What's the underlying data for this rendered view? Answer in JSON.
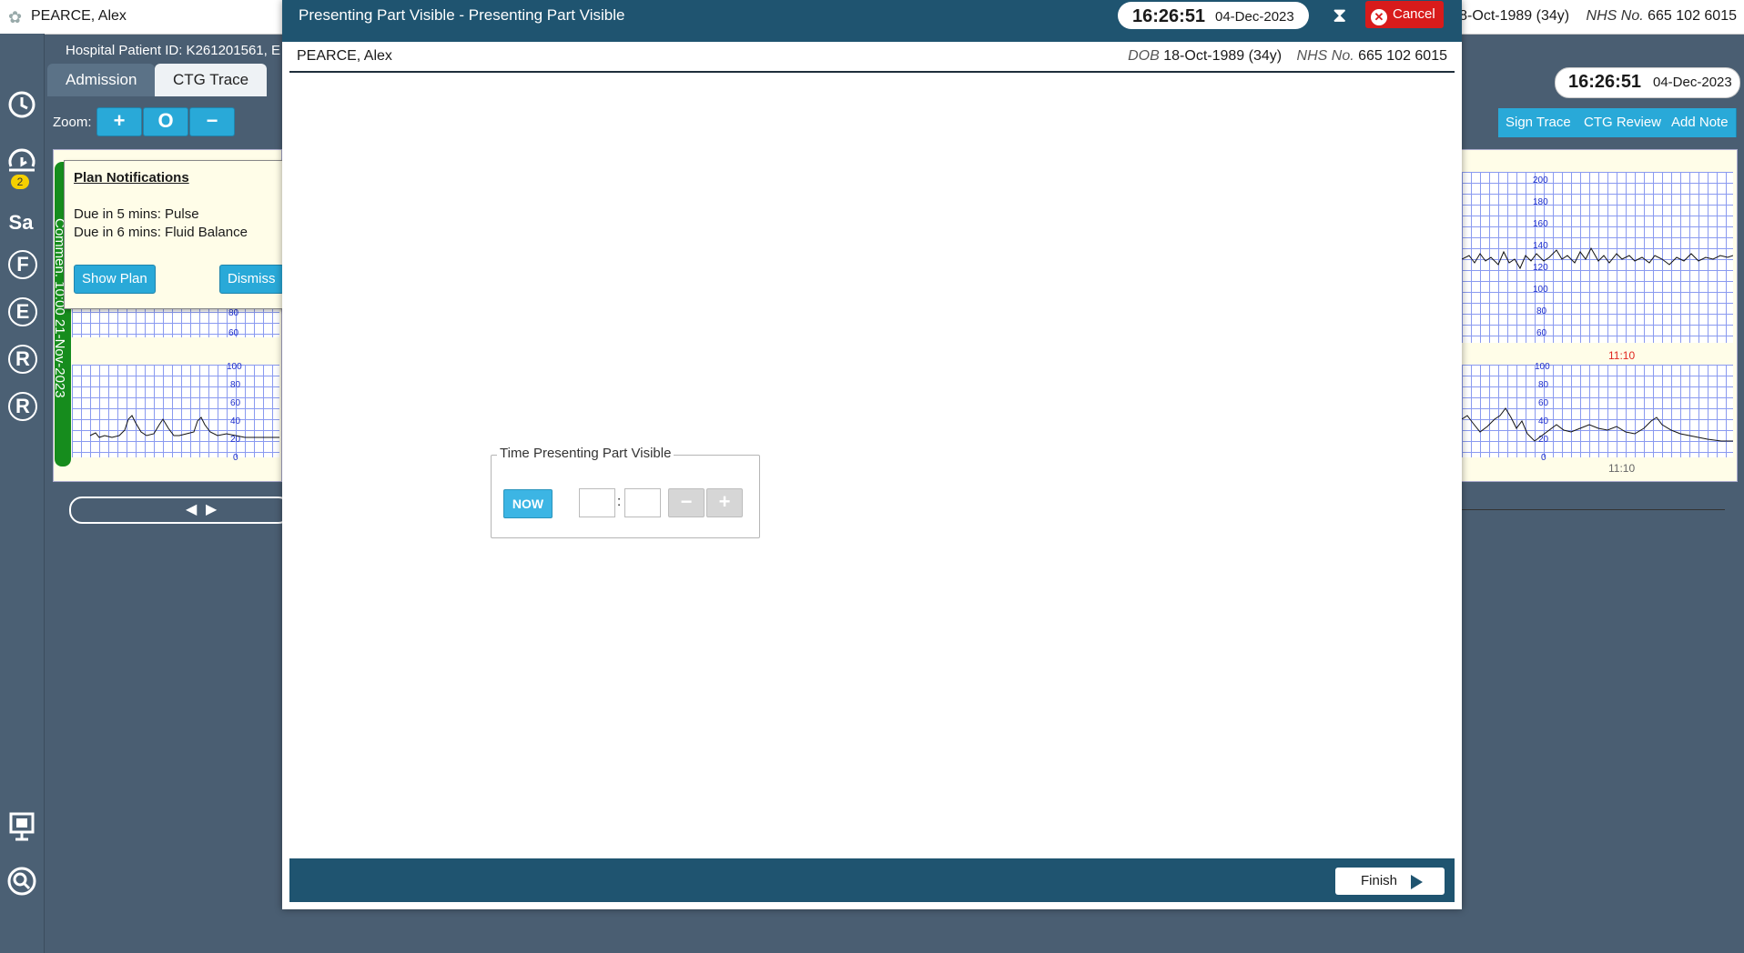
{
  "topbar": {
    "patient_name": "PEARCE, Alex",
    "dob_value": "18-Oct-1989 (34y)",
    "nhs_label": "NHS No.",
    "nhs_value": "665 102 6015"
  },
  "patient_row": {
    "hospital_id": "Hospital Patient ID: K261201561,   E"
  },
  "rail": {
    "alarm_badge": "2",
    "letters": [
      "Sa",
      "F",
      "E",
      "R",
      "R"
    ]
  },
  "tabs": {
    "admission": "Admission",
    "ctg": "CTG Trace"
  },
  "zoom": {
    "label": "Zoom:",
    "plus": "+",
    "reset": "O",
    "minus": "−"
  },
  "trace": {
    "green_label": "Commen. 10:00 21-Nov-2023",
    "fhr_ticks": [
      "200",
      "180",
      "160",
      "140",
      "120",
      "100",
      "80",
      "60"
    ],
    "toco_ticks": [
      "100",
      "80",
      "60",
      "40",
      "20",
      "0"
    ],
    "time_red": "11:10",
    "time_grey": "11:10"
  },
  "notification": {
    "title": "Plan Notifications",
    "line1": "Due in 5 mins: Pulse",
    "line2": "Due in 6 mins: Fluid Balance",
    "show_plan": "Show Plan",
    "dismiss": "Dismiss"
  },
  "right_actions": {
    "sign_trace": "Sign Trace",
    "ctg_review": "CTG Review",
    "add_note": "Add Note"
  },
  "main_clock": {
    "time": "16:26:51",
    "date": "04-Dec-2023"
  },
  "modal": {
    "title": "Presenting Part Visible - Presenting Part Visible",
    "clock_time": "16:26:51",
    "clock_date": "04-Dec-2023",
    "cancel": "Cancel",
    "patient_name": "PEARCE, Alex",
    "dob_label": "DOB",
    "dob_value": "18-Oct-1989 (34y)",
    "nhs_label": "NHS No.",
    "nhs_value": "665 102 6015",
    "fieldset_legend": "Time Presenting Part Visible",
    "now_button": "NOW",
    "hour_value": "",
    "minute_value": "",
    "colon": ":",
    "minus": "−",
    "plus": "+",
    "finish": "Finish"
  }
}
